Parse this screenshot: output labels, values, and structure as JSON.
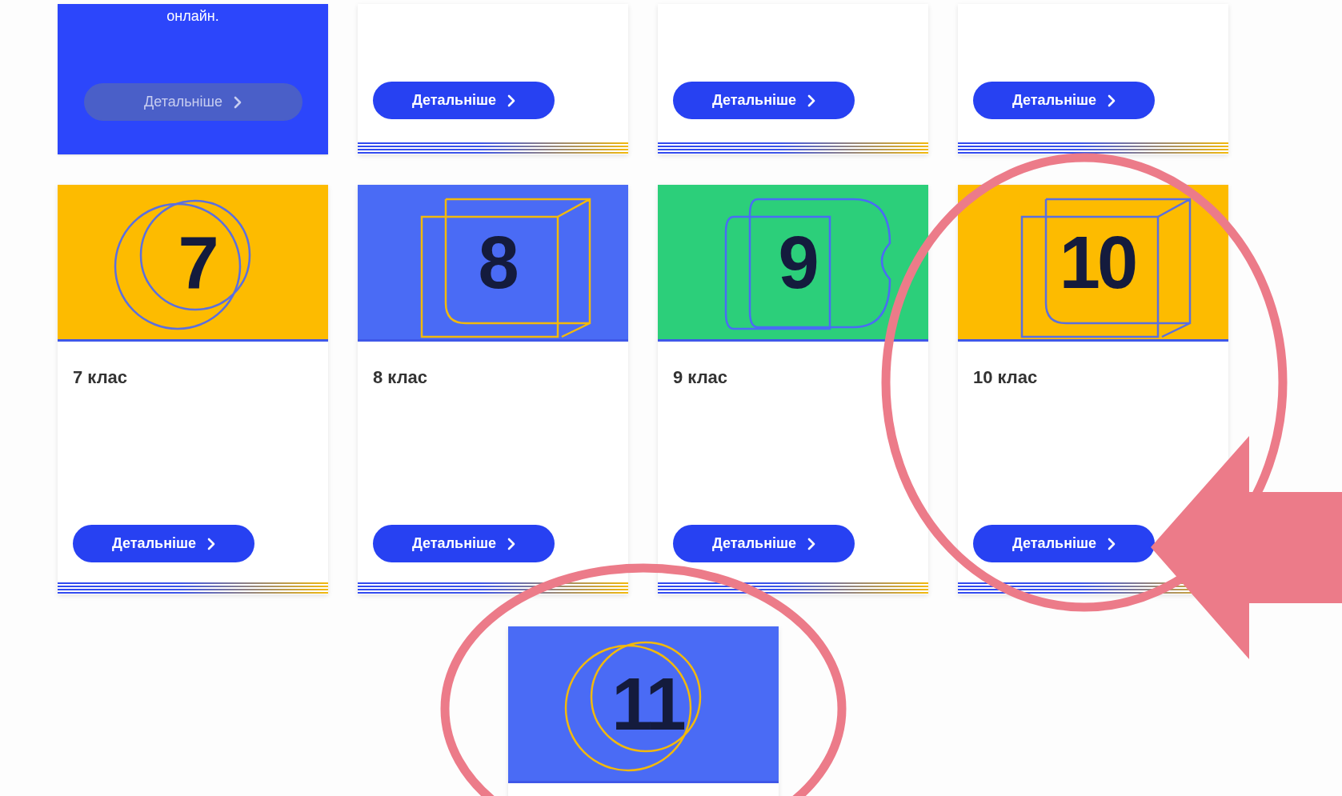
{
  "top_cards": [
    {
      "kind": "promo",
      "text": "онлайн.",
      "button": {
        "label": "Детальніше",
        "disabled": true
      }
    },
    {
      "kind": "plain",
      "button": {
        "label": "Детальніше",
        "disabled": false
      }
    },
    {
      "kind": "plain",
      "button": {
        "label": "Детальніше",
        "disabled": false
      }
    },
    {
      "kind": "plain",
      "button": {
        "label": "Детальніше",
        "disabled": false
      }
    }
  ],
  "grade_cards": [
    {
      "number": "7",
      "title": "7 клас",
      "color": "#fdbb00",
      "kind": "rings",
      "button": {
        "label": "Детальніше",
        "disabled": false
      }
    },
    {
      "number": "8",
      "title": "8 клас",
      "color": "#4a6bf5",
      "kind": "cube",
      "button": {
        "label": "Детальніше",
        "disabled": false
      }
    },
    {
      "number": "9",
      "title": "9 клас",
      "color": "#2ccf7a",
      "kind": "blob",
      "button": {
        "label": "Детальніше",
        "disabled": false
      }
    },
    {
      "number": "10",
      "title": "10 клас",
      "color": "#fdbb00",
      "kind": "cube",
      "button": {
        "label": "Детальніше",
        "disabled": false
      }
    },
    {
      "number": "11",
      "color": "#4a6bf5",
      "kind": "rings"
    }
  ],
  "annotations": [
    {
      "kind": "ellipse"
    },
    {
      "kind": "ellipse"
    },
    {
      "kind": "arrow"
    }
  ]
}
